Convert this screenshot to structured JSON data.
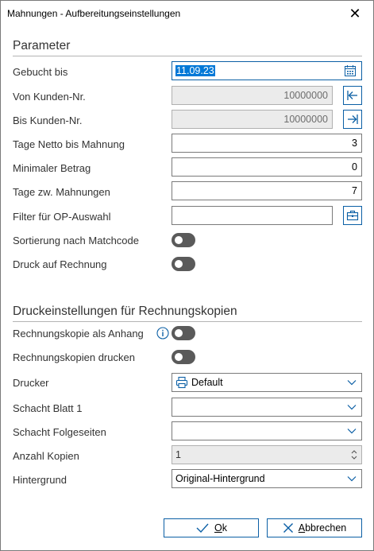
{
  "window": {
    "title": "Mahnungen - Aufbereitungseinstellungen",
    "close_glyph": "✕"
  },
  "parameter": {
    "section_title": "Parameter",
    "gebucht_bis": {
      "label": "Gebucht bis",
      "value": "11.09.23"
    },
    "von_kunden": {
      "label": "Von Kunden-Nr.",
      "value": "10000000"
    },
    "bis_kunden": {
      "label": "Bis Kunden-Nr.",
      "value": "10000000"
    },
    "tage_netto": {
      "label": "Tage Netto bis Mahnung",
      "value": "3"
    },
    "min_betrag": {
      "label": "Minimaler Betrag",
      "value": "0"
    },
    "tage_zw": {
      "label": "Tage zw. Mahnungen",
      "value": "7"
    },
    "filter_op": {
      "label": "Filter für OP-Auswahl",
      "value": ""
    },
    "sortierung": {
      "label": "Sortierung nach Matchcode",
      "on": false
    },
    "druck_rechnung": {
      "label": "Druck auf Rechnung",
      "on": false
    }
  },
  "druck": {
    "section_title": "Druckeinstellungen für Rechnungskopien",
    "kopie_anhang": {
      "label": "Rechnungskopie als Anhang",
      "on": false
    },
    "kopien_drucken": {
      "label": "Rechnungskopien drucken",
      "on": false
    },
    "drucker": {
      "label": "Drucker",
      "value": "Default"
    },
    "schacht1": {
      "label": "Schacht Blatt 1",
      "value": ""
    },
    "schacht_folge": {
      "label": "Schacht Folgeseiten",
      "value": ""
    },
    "anzahl": {
      "label": "Anzahl Kopien",
      "value": "1"
    },
    "hintergrund": {
      "label": "Hintergrund",
      "value": "Original-Hintergrund"
    }
  },
  "buttons": {
    "ok_access": "O",
    "ok_rest": "k",
    "cancel_access": "A",
    "cancel_rest": "bbrechen"
  },
  "colors": {
    "accent": "#0b5fa5",
    "selection": "#0078d7",
    "toggle_off": "#5a5a5a"
  },
  "icons": [
    "calendar-icon",
    "arrow-left-bar-icon",
    "arrow-right-bar-icon",
    "briefcase-icon",
    "info-icon",
    "printer-icon",
    "chevron-down-icon",
    "check-icon",
    "x-icon"
  ]
}
